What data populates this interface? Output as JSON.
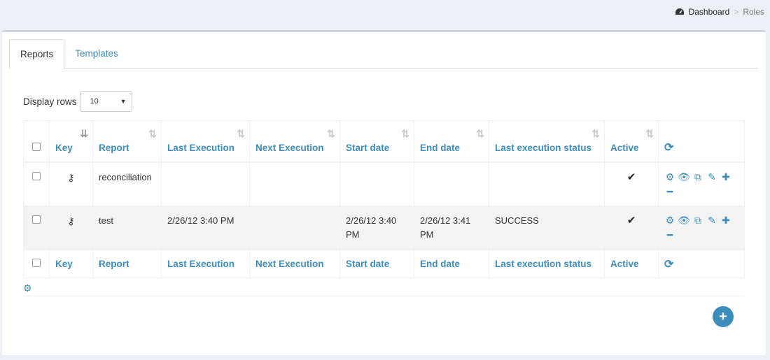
{
  "breadcrumb": {
    "home": "Dashboard",
    "current": "Roles",
    "separator": ">"
  },
  "tabs": [
    {
      "label": "Reports"
    },
    {
      "label": "Templates"
    }
  ],
  "display_rows": {
    "label": "Display rows",
    "value": "10"
  },
  "table": {
    "columns": [
      "Key",
      "Report",
      "Last Execution",
      "Next Execution",
      "Start date",
      "End date",
      "Last execution status",
      "Active"
    ],
    "rows": [
      {
        "report": "reconciliation",
        "last_execution": "",
        "next_execution": "",
        "start_date": "",
        "end_date": "",
        "status": "",
        "active": true
      },
      {
        "report": "test",
        "last_execution": "2/26/12 3:40 PM",
        "next_execution": "",
        "start_date": "2/26/12 3:40 PM",
        "end_date": "2/26/12 3:41 PM",
        "status": "SUCCESS",
        "active": true
      }
    ]
  },
  "icons": {
    "sort": "⇅",
    "sort_active": "⇊",
    "refresh": "⟳",
    "key": "⚷",
    "check": "✔",
    "gear": "⚙",
    "eye": "👁",
    "copy": "⧉",
    "pencil": "✎",
    "puzzle": "✚",
    "minus": "━",
    "plus": "+"
  },
  "colors": {
    "accent": "#3c8dbc"
  }
}
